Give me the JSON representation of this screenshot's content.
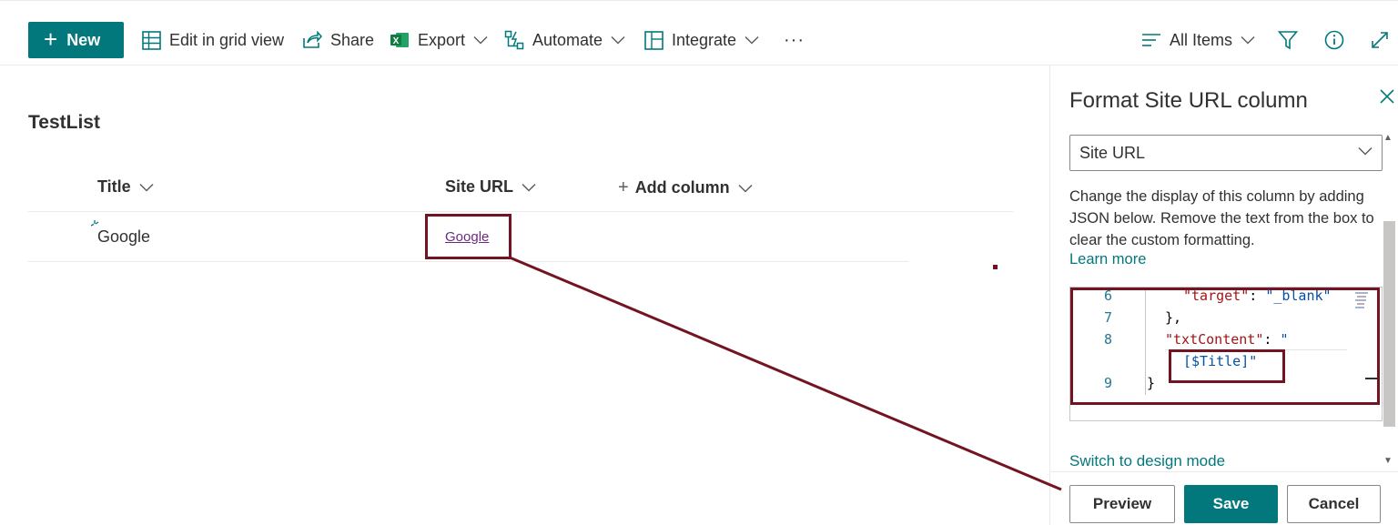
{
  "command_bar": {
    "new_label": "New",
    "edit_grid_label": "Edit in grid view",
    "share_label": "Share",
    "export_label": "Export",
    "automate_label": "Automate",
    "integrate_label": "Integrate",
    "more_label": "···",
    "view_label": "All Items"
  },
  "list": {
    "title": "TestList",
    "columns": {
      "title": "Title",
      "site_url": "Site URL",
      "add_column": "Add column"
    },
    "rows": [
      {
        "title": "Google",
        "site_url": "Google"
      }
    ]
  },
  "panel": {
    "title": "Format Site URL column",
    "dropdown_value": "Site URL",
    "description": "Change the display of this column by adding JSON below. Remove the text from the box to clear the custom formatting.",
    "learn_more": "Learn more",
    "code_lines": [
      {
        "num": "6",
        "key": "\"target\"",
        "sep": ": ",
        "val": "\"_blank\""
      },
      {
        "num": "7",
        "text": "},"
      },
      {
        "num": "8",
        "key": "\"txtContent\"",
        "sep": ": ",
        "val": "\""
      },
      {
        "num": "",
        "val": "[$Title]\""
      },
      {
        "num": "9",
        "text": "}"
      }
    ],
    "switch_mode": "Switch to design mode",
    "buttons": {
      "preview": "Preview",
      "save": "Save",
      "cancel": "Cancel"
    }
  },
  "colors": {
    "accent": "#03787c",
    "annotation": "#731422",
    "link_visited": "#6b2a82"
  }
}
